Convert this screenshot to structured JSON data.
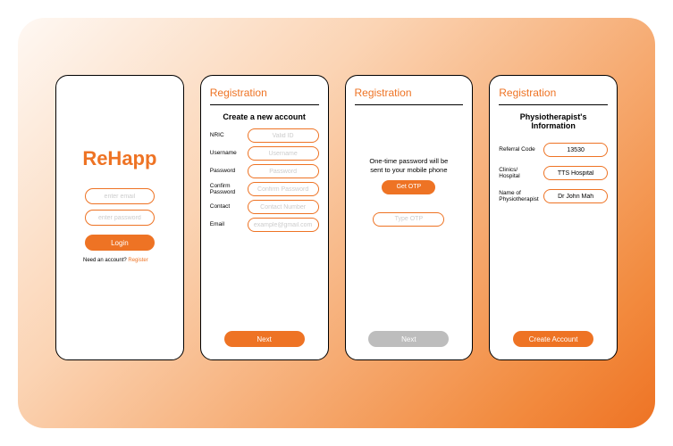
{
  "app": {
    "title": "ReHapp"
  },
  "login": {
    "email_placeholder": "enter email",
    "password_placeholder": "enter password",
    "login_label": "Login",
    "need_account_text": "Need an account? ",
    "register_link": "Register"
  },
  "reg1": {
    "heading": "Registration",
    "subheading": "Create a new account",
    "fields": {
      "nric": {
        "label": "NRIC",
        "placeholder": "Valid ID"
      },
      "username": {
        "label": "Username",
        "placeholder": "Username"
      },
      "password": {
        "label": "Password",
        "placeholder": "Password"
      },
      "confirm": {
        "label": "Confirm Password",
        "placeholder": "Confirm Password"
      },
      "contact": {
        "label": "Contact",
        "placeholder": "Contact Number"
      },
      "email": {
        "label": "Email",
        "placeholder": "example@gmail.com"
      }
    },
    "next_label": "Next"
  },
  "reg2": {
    "heading": "Registration",
    "otp_text": "One-time password will be sent to your mobile phone",
    "get_otp_label": "Get OTP",
    "otp_placeholder": "Type OTP",
    "next_label": "Next"
  },
  "reg3": {
    "heading": "Registration",
    "subheading": "Physiotherapist's Information",
    "fields": {
      "referral": {
        "label": "Referral Code",
        "value": "13530"
      },
      "clinic": {
        "label": "Clinics/ Hospital",
        "value": "TTS Hospital"
      },
      "physio": {
        "label": "Name of Physiotherapist",
        "value": "Dr John Mah"
      }
    },
    "create_label": "Create Account"
  }
}
